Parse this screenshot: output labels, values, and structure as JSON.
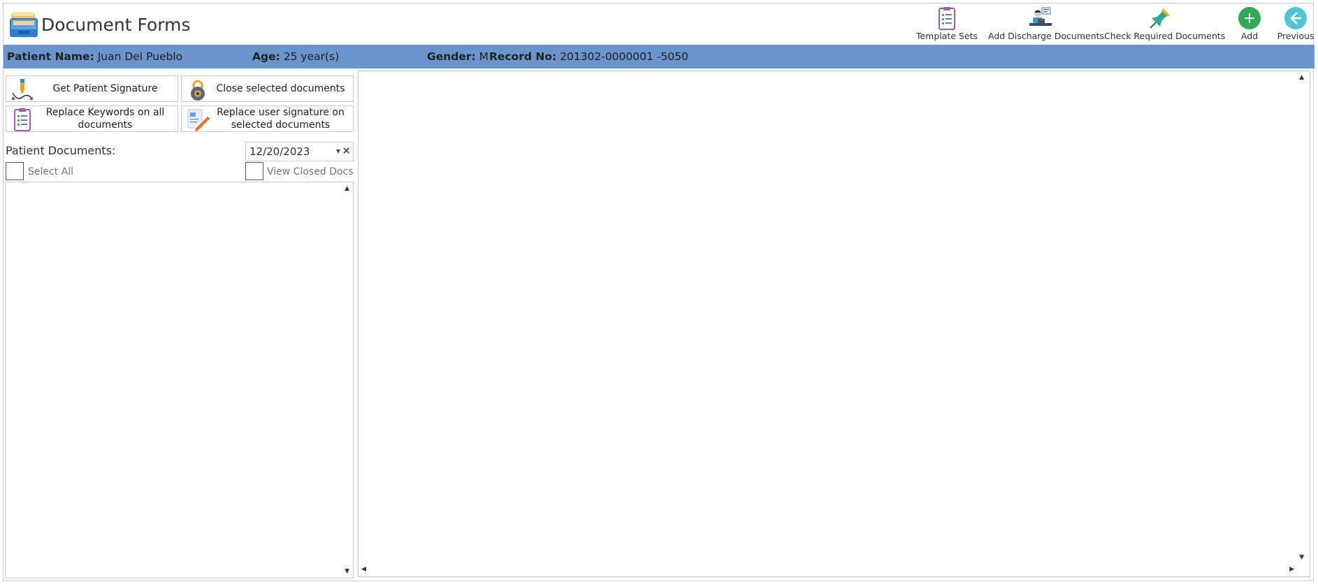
{
  "app": {
    "title": "Document Forms",
    "icon": "document-tray-icon"
  },
  "toolbar": {
    "template_sets": "Template Sets",
    "add_discharge": "Add Discharge Documents",
    "check_required": "Check Required Documents",
    "add": "Add",
    "previous": "Previous"
  },
  "patient": {
    "name_label": "Patient Name:",
    "name": "Juan Del Pueblo",
    "age_label": "Age:",
    "age": "25 year(s)",
    "gender_label": "Gender:",
    "gender": "M",
    "record_label": "Record No:",
    "record": "201302-0000001 -5050"
  },
  "actions": {
    "get_signature": "Get Patient Signature",
    "close_docs": "Close selected documents",
    "replace_keywords": "Replace Keywords on all documents",
    "replace_signature": "Replace user signature on selected documents"
  },
  "documents": {
    "label": "Patient Documents:",
    "date": "12/20/2023",
    "clear": "✕",
    "dropdown": "▾",
    "select_all": "Select All",
    "view_closed": "View Closed Docs"
  },
  "scroll": {
    "up": "▲",
    "down": "▼",
    "left": "◀",
    "right": "▶"
  },
  "colors": {
    "patient_bar": "#6a95cc",
    "add_green": "#2eab55",
    "previous_teal": "#4fc3d6"
  }
}
